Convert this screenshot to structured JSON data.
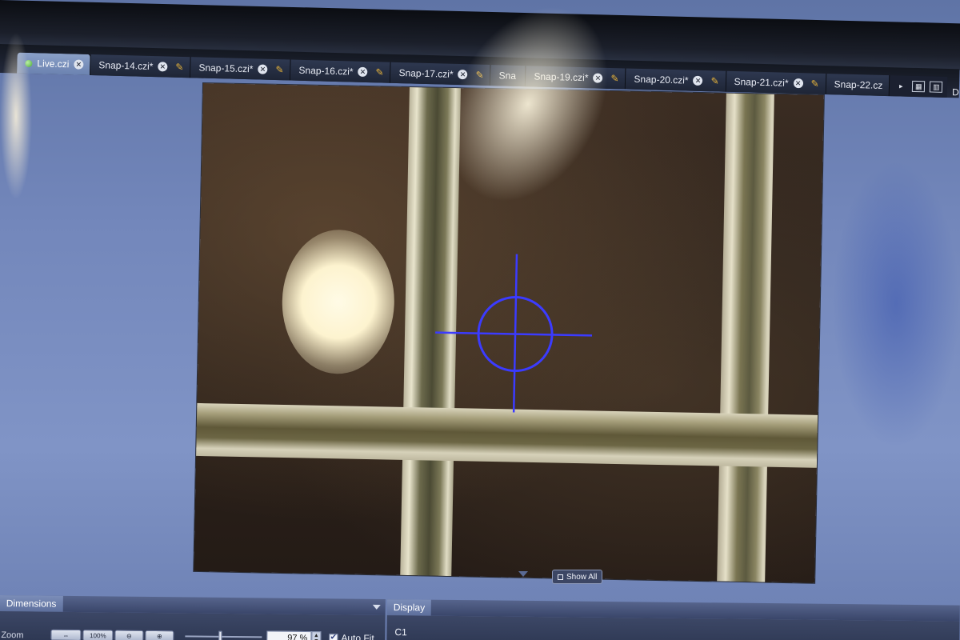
{
  "tabs": [
    {
      "label": "Live.czi",
      "active": true,
      "status_dot": true
    },
    {
      "label": "Snap-14.czi*"
    },
    {
      "label": "Snap-15.czi*"
    },
    {
      "label": "Snap-16.czi*"
    },
    {
      "label": "Snap-17.czi*"
    },
    {
      "label": "Sna"
    },
    {
      "label": "Snap-19.czi*"
    },
    {
      "label": "Snap-20.czi*"
    },
    {
      "label": "Snap-21.czi*"
    },
    {
      "label": "Snap-22.cz"
    }
  ],
  "edge_label": "D",
  "viewer": {
    "show_all_label": "Show All",
    "crosshair_color": "#3b3bff"
  },
  "dimensions_panel": {
    "title": "Dimensions",
    "zoom_label": "Zoom",
    "btn_100": "100%",
    "zoom_value": "97 %",
    "autofit_label": "Auto Fit",
    "autofit_checked": true
  },
  "display_panel": {
    "title": "Display",
    "channel_label": "C1"
  },
  "colors": {
    "accent": "#6b82b0",
    "edit_pen": "#e8b43a"
  }
}
